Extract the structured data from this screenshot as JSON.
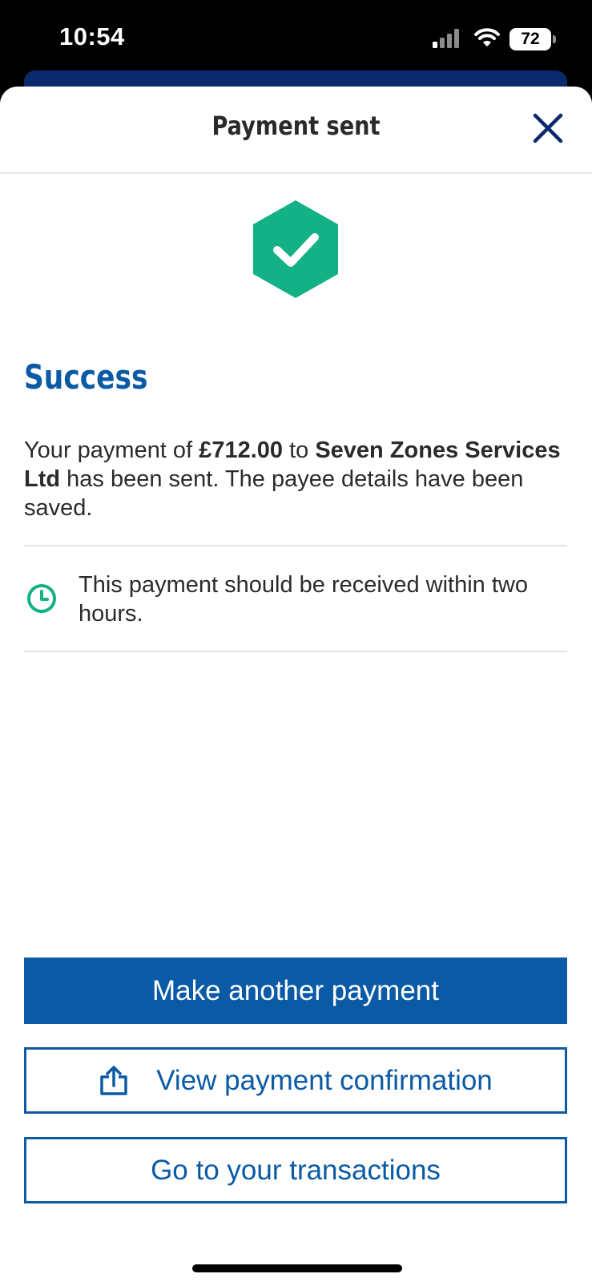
{
  "status_bar": {
    "time": "10:54",
    "battery": "72",
    "icons": [
      "signal-icon",
      "wifi-icon",
      "battery-icon"
    ]
  },
  "header": {
    "title": "Payment sent",
    "close_icon": "close-icon"
  },
  "success": {
    "icon": "success-check-icon",
    "heading": "Success",
    "message_prefix": "Your payment of ",
    "amount": "£712.00",
    "message_middle": " to ",
    "payee": "Seven Zones Services Ltd",
    "message_suffix": " has been sent. The payee details have been saved."
  },
  "delivery": {
    "icon": "clock-icon",
    "note": "This payment should be received within two hours."
  },
  "actions": {
    "make_another": "Make another payment",
    "view_confirmation": "View payment confirmation",
    "view_confirmation_icon": "share-icon",
    "go_transactions": "Go to your transactions"
  },
  "colors": {
    "brand_blue": "#0a5aa5",
    "success_green": "#13b185",
    "navy": "#0b2a6e"
  }
}
